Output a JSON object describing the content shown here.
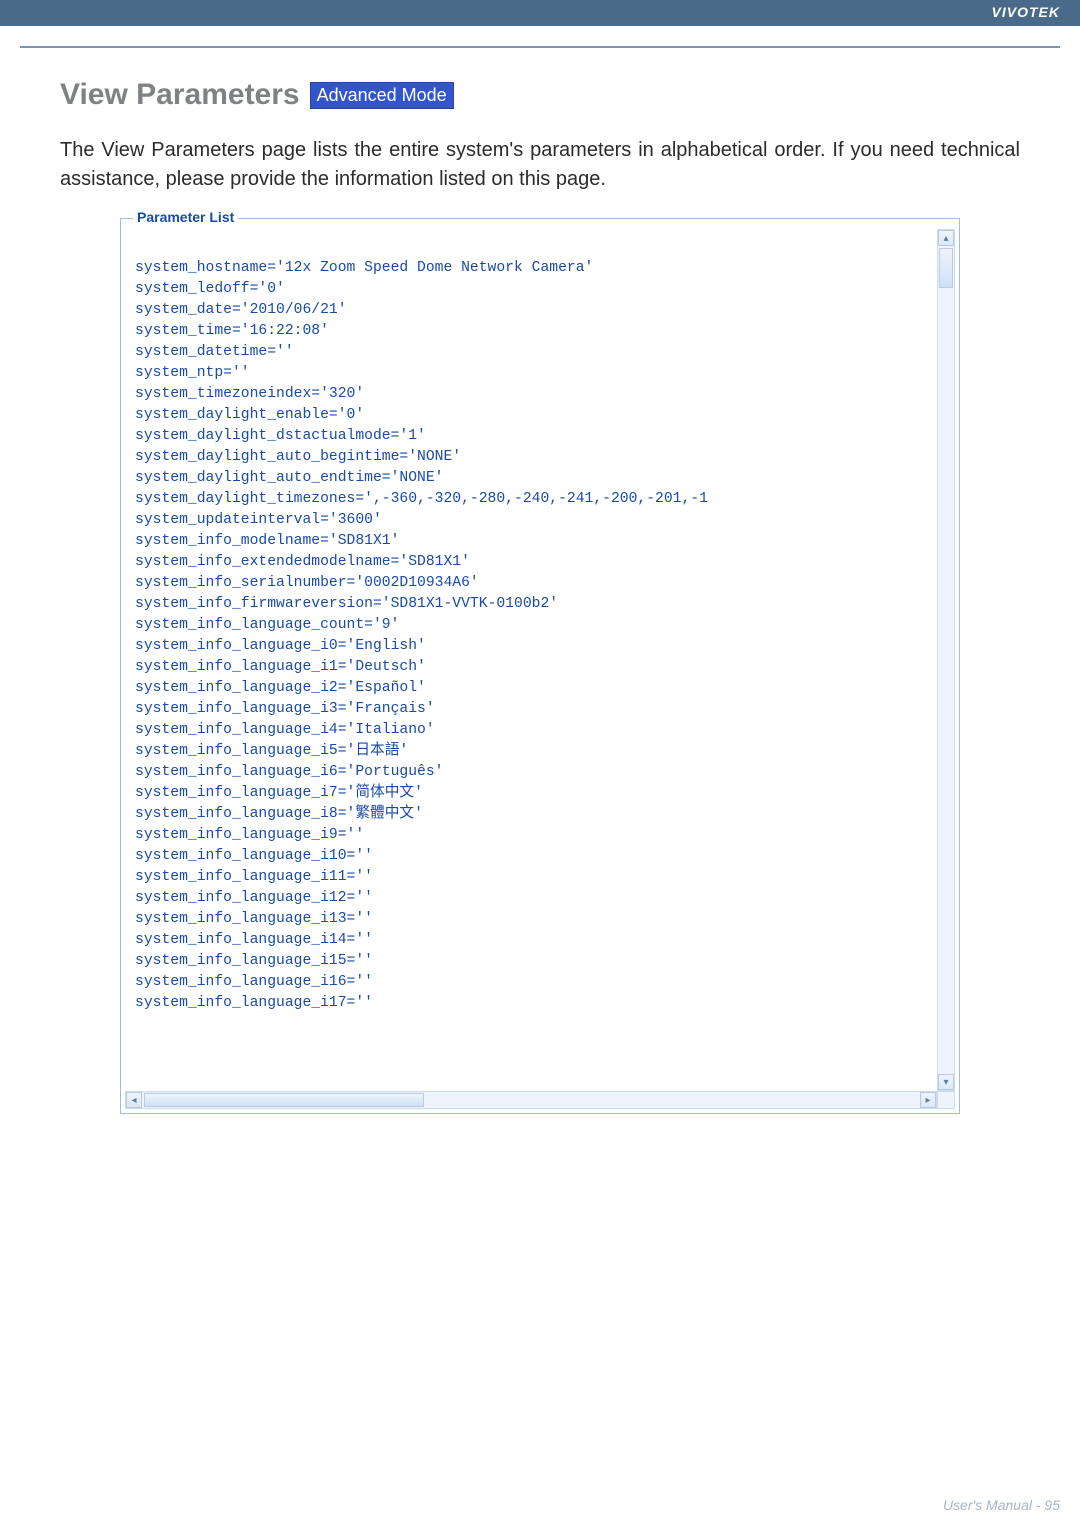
{
  "header": {
    "brand": "VIVOTEK"
  },
  "page": {
    "title": "View Parameters",
    "badge": "Advanced Mode",
    "description": "The View Parameters page lists the entire system's parameters in alphabetical order. If you need technical assistance, please provide the information listed on this page."
  },
  "panel": {
    "legend": "Parameter List",
    "lines": [
      "system_hostname='12x Zoom Speed Dome Network Camera'",
      "system_ledoff='0'",
      "system_date='2010/06/21'",
      "system_time='16:22:08'",
      "system_datetime=''",
      "system_ntp=''",
      "system_timezoneindex='320'",
      "system_daylight_enable='0'",
      "system_daylight_dstactualmode='1'",
      "system_daylight_auto_begintime='NONE'",
      "system_daylight_auto_endtime='NONE'",
      "system_daylight_timezones=',-360,-320,-280,-240,-241,-200,-201,-1",
      "system_updateinterval='3600'",
      "system_info_modelname='SD81X1'",
      "system_info_extendedmodelname='SD81X1'",
      "system_info_serialnumber='0002D10934A6'",
      "system_info_firmwareversion='SD81X1-VVTK-0100b2'",
      "system_info_language_count='9'",
      "system_info_language_i0='English'",
      "system_info_language_i1='Deutsch'",
      "system_info_language_i2='Español'",
      "system_info_language_i3='Français'",
      "system_info_language_i4='Italiano'",
      "system_info_language_i5='日本語'",
      "system_info_language_i6='Português'",
      "system_info_language_i7='简体中文'",
      "system_info_language_i8='繁體中文'",
      "system_info_language_i9=''",
      "system_info_language_i10=''",
      "system_info_language_i11=''",
      "system_info_language_i12=''",
      "system_info_language_i13=''",
      "system_info_language_i14=''",
      "system_info_language_i15=''",
      "system_info_language_i16=''",
      "system_info_language_i17=''"
    ]
  },
  "footer": {
    "text": "User's Manual - 95"
  },
  "icons": {
    "up": "▴",
    "down": "▾",
    "left": "◂",
    "right": "▸"
  }
}
